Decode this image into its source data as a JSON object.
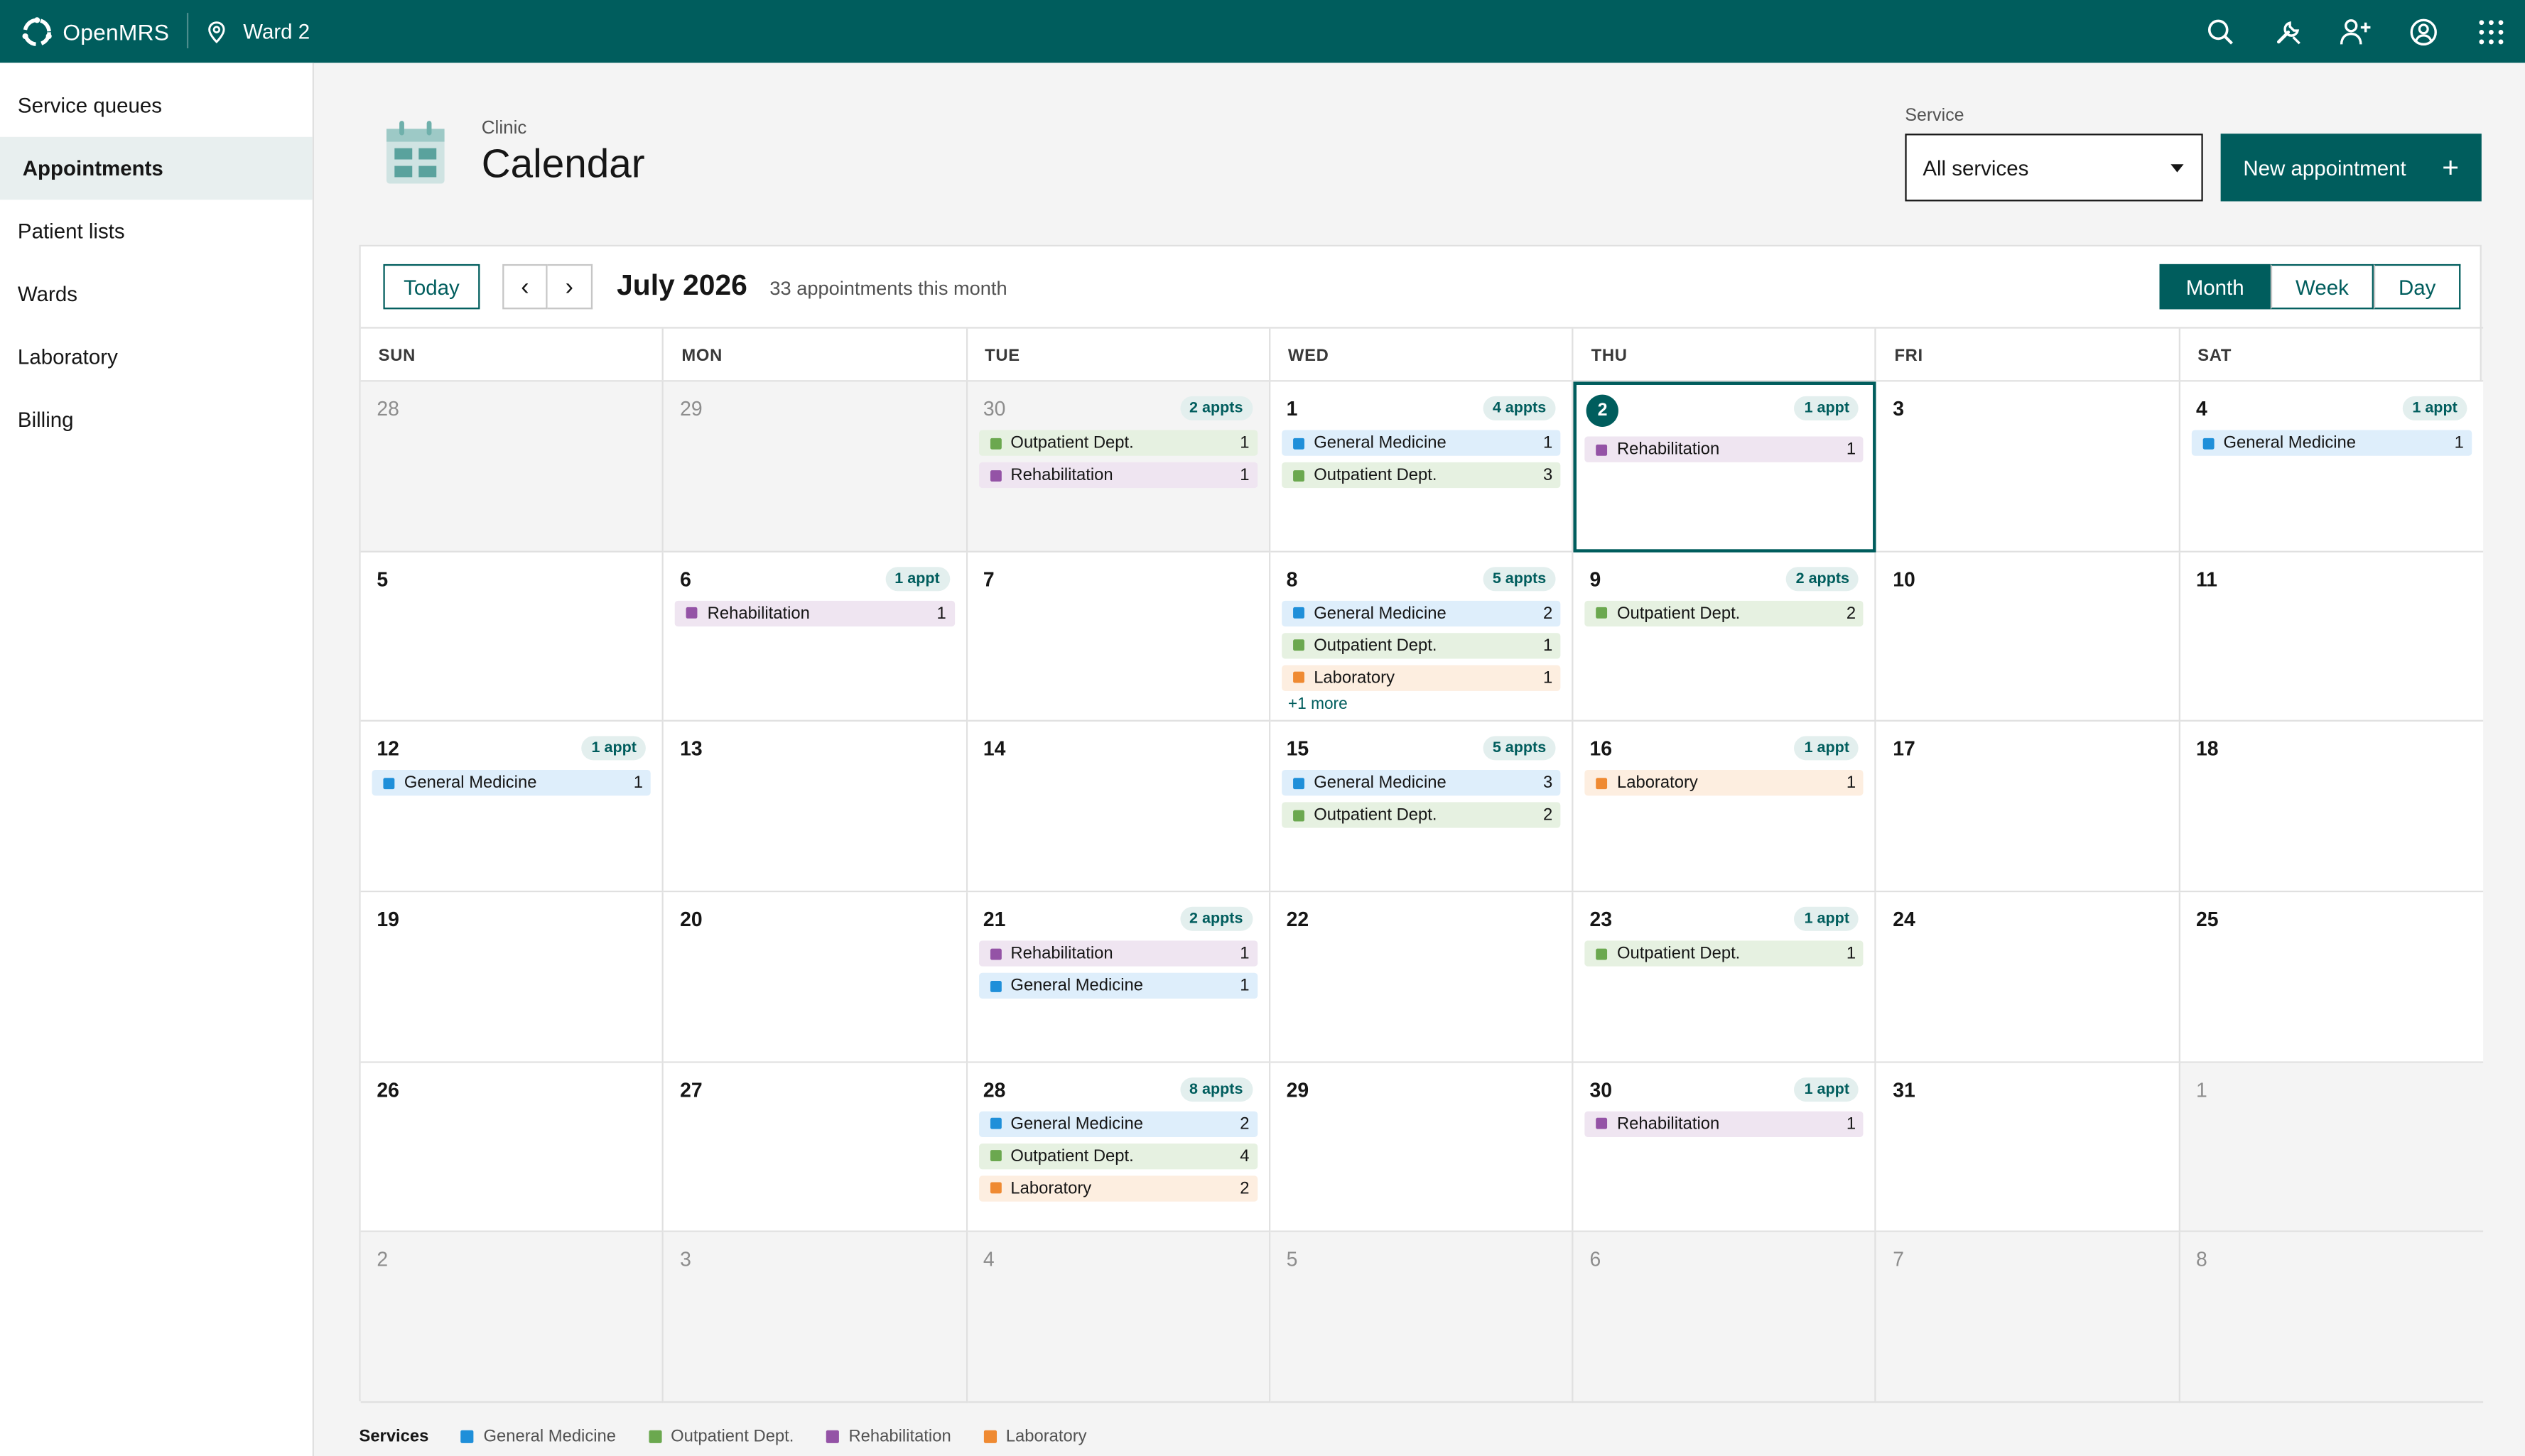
{
  "app": {
    "name": "OpenMRS",
    "location": "Ward 2"
  },
  "topbar_icons": [
    "search-icon",
    "tools-icon",
    "add-user-icon",
    "user-avatar-icon",
    "app-switcher-icon"
  ],
  "sidebar": {
    "items": [
      {
        "label": "Service queues",
        "active": false
      },
      {
        "label": "Appointments",
        "active": true
      },
      {
        "label": "Patient lists",
        "active": false
      },
      {
        "label": "Wards",
        "active": false
      },
      {
        "label": "Laboratory",
        "active": false
      },
      {
        "label": "Billing",
        "active": false
      }
    ]
  },
  "header": {
    "subtitle": "Clinic",
    "title": "Calendar",
    "service_label": "Service",
    "service_value": "All services",
    "new_button": "New appointment"
  },
  "toolbar": {
    "today": "Today",
    "prev": "‹",
    "next": "›",
    "month": "July 2026",
    "count": "33 appointments this month",
    "views": [
      {
        "label": "Month",
        "active": true
      },
      {
        "label": "Week",
        "active": false
      },
      {
        "label": "Day",
        "active": false
      }
    ]
  },
  "colors": {
    "brand": "#005d5d",
    "General Medicine": {
      "dot": "#1f8fd9",
      "bg": "#deeefb"
    },
    "Outpatient Dept.": {
      "dot": "#6ba84f",
      "bg": "#e6f1e1"
    },
    "Rehabilitation": {
      "dot": "#9453a6",
      "bg": "#efe5f1"
    },
    "Laboratory": {
      "dot": "#ef8a32",
      "bg": "#fdeee0"
    }
  },
  "weekdays": [
    "SUN",
    "MON",
    "TUE",
    "WED",
    "THU",
    "FRI",
    "SAT"
  ],
  "weeks": [
    [
      {
        "day": "28",
        "out": true,
        "items": []
      },
      {
        "day": "29",
        "out": true,
        "items": []
      },
      {
        "day": "30",
        "out": true,
        "badge": "2 appts",
        "items": [
          {
            "service": "Outpatient Dept.",
            "count": "1"
          },
          {
            "service": "Rehabilitation",
            "count": "1"
          }
        ]
      },
      {
        "day": "1",
        "badge": "4 appts",
        "items": [
          {
            "service": "General Medicine",
            "count": "1"
          },
          {
            "service": "Outpatient Dept.",
            "count": "3"
          }
        ]
      },
      {
        "day": "2",
        "today": true,
        "badge": "1 appt",
        "items": [
          {
            "service": "Rehabilitation",
            "count": "1"
          }
        ]
      },
      {
        "day": "3",
        "items": []
      },
      {
        "day": "4",
        "badge": "1 appt",
        "items": [
          {
            "service": "General Medicine",
            "count": "1"
          }
        ]
      }
    ],
    [
      {
        "day": "5",
        "items": []
      },
      {
        "day": "6",
        "badge": "1 appt",
        "items": [
          {
            "service": "Rehabilitation",
            "count": "1"
          }
        ]
      },
      {
        "day": "7",
        "items": []
      },
      {
        "day": "8",
        "badge": "5 appts",
        "items": [
          {
            "service": "General Medicine",
            "count": "2"
          },
          {
            "service": "Outpatient Dept.",
            "count": "1"
          },
          {
            "service": "Laboratory",
            "count": "1"
          }
        ],
        "more": "+1 more"
      },
      {
        "day": "9",
        "badge": "2 appts",
        "items": [
          {
            "service": "Outpatient Dept.",
            "count": "2"
          }
        ]
      },
      {
        "day": "10",
        "items": []
      },
      {
        "day": "11",
        "items": []
      }
    ],
    [
      {
        "day": "12",
        "badge": "1 appt",
        "items": [
          {
            "service": "General Medicine",
            "count": "1"
          }
        ]
      },
      {
        "day": "13",
        "items": []
      },
      {
        "day": "14",
        "items": []
      },
      {
        "day": "15",
        "badge": "5 appts",
        "items": [
          {
            "service": "General Medicine",
            "count": "3"
          },
          {
            "service": "Outpatient Dept.",
            "count": "2"
          }
        ]
      },
      {
        "day": "16",
        "badge": "1 appt",
        "items": [
          {
            "service": "Laboratory",
            "count": "1"
          }
        ]
      },
      {
        "day": "17",
        "items": []
      },
      {
        "day": "18",
        "items": []
      }
    ],
    [
      {
        "day": "19",
        "items": []
      },
      {
        "day": "20",
        "items": []
      },
      {
        "day": "21",
        "badge": "2 appts",
        "items": [
          {
            "service": "Rehabilitation",
            "count": "1"
          },
          {
            "service": "General Medicine",
            "count": "1"
          }
        ]
      },
      {
        "day": "22",
        "items": []
      },
      {
        "day": "23",
        "badge": "1 appt",
        "items": [
          {
            "service": "Outpatient Dept.",
            "count": "1"
          }
        ]
      },
      {
        "day": "24",
        "items": []
      },
      {
        "day": "25",
        "items": []
      }
    ],
    [
      {
        "day": "26",
        "items": []
      },
      {
        "day": "27",
        "items": []
      },
      {
        "day": "28",
        "badge": "8 appts",
        "items": [
          {
            "service": "General Medicine",
            "count": "2"
          },
          {
            "service": "Outpatient Dept.",
            "count": "4"
          },
          {
            "service": "Laboratory",
            "count": "2"
          }
        ]
      },
      {
        "day": "29",
        "items": []
      },
      {
        "day": "30",
        "badge": "1 appt",
        "items": [
          {
            "service": "Rehabilitation",
            "count": "1"
          }
        ]
      },
      {
        "day": "31",
        "items": []
      },
      {
        "day": "1",
        "out": true,
        "items": []
      }
    ],
    [
      {
        "day": "2",
        "out": true,
        "items": []
      },
      {
        "day": "3",
        "out": true,
        "items": []
      },
      {
        "day": "4",
        "out": true,
        "items": []
      },
      {
        "day": "5",
        "out": true,
        "items": []
      },
      {
        "day": "6",
        "out": true,
        "items": []
      },
      {
        "day": "7",
        "out": true,
        "items": []
      },
      {
        "day": "8",
        "out": true,
        "items": []
      }
    ]
  ],
  "legend": {
    "title": "Services",
    "items": [
      "General Medicine",
      "Outpatient Dept.",
      "Rehabilitation",
      "Laboratory"
    ]
  }
}
